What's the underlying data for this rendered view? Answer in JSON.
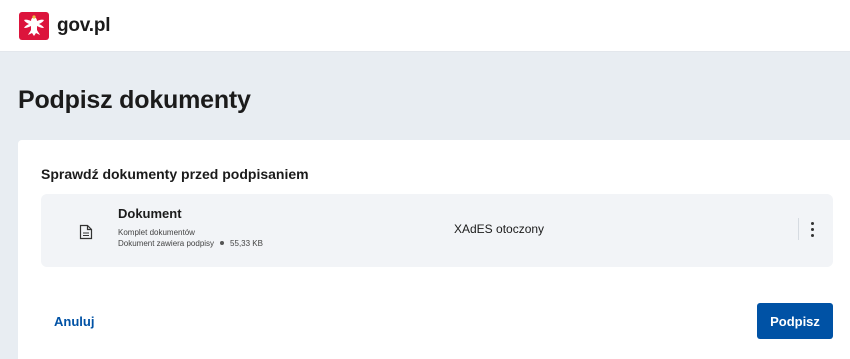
{
  "header": {
    "logo_icon": "polish-eagle-emblem-icon",
    "brand": "gov.pl"
  },
  "page": {
    "title": "Podpisz dokumenty"
  },
  "card": {
    "heading": "Sprawdź dokumenty przed podpisaniem",
    "document": {
      "icon": "document-icon",
      "name": "Dokument",
      "subtitle": "Komplet dokumentów",
      "status": "Dokument zawiera podpisy",
      "size": "55,33 KB",
      "format": "XAdES otoczony",
      "menu_icon": "more-vertical-icon"
    },
    "actions": {
      "cancel_label": "Anuluj",
      "sign_label": "Podpisz"
    }
  },
  "colors": {
    "background": "#e8edf2",
    "primary": "#0052a5",
    "emblem_red": "#dc143c"
  }
}
